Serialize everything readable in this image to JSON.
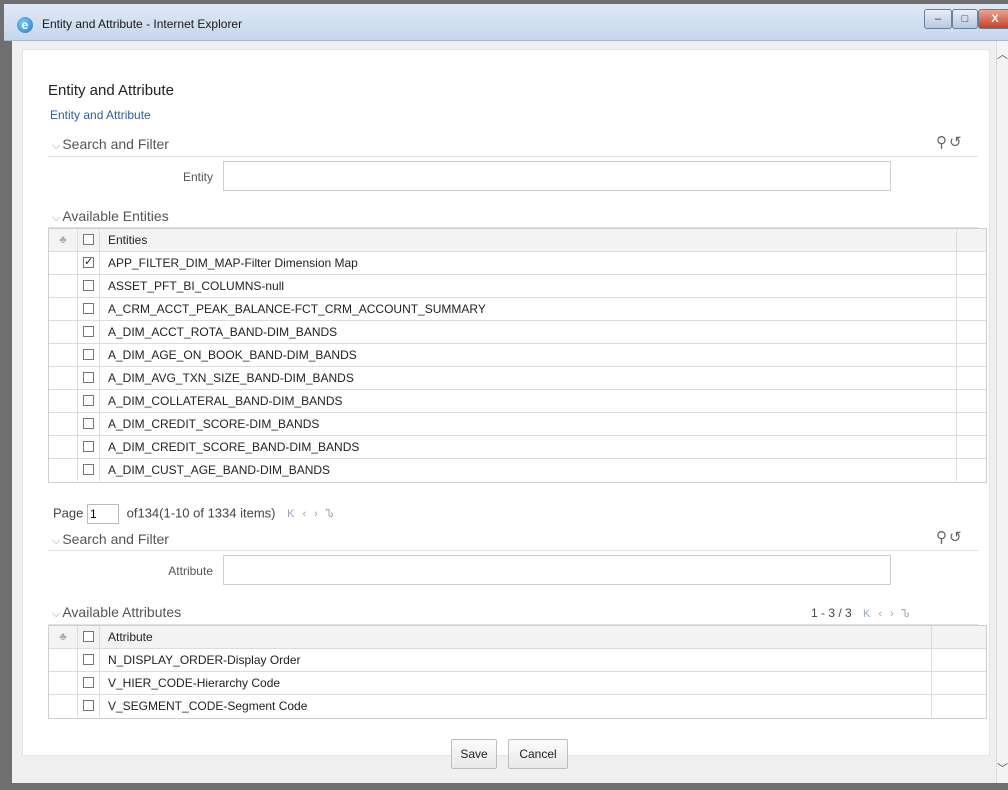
{
  "window": {
    "title": "Entity and Attribute - Internet Explorer",
    "app_icon": "internet-explorer-icon",
    "controls": {
      "minimize": "–",
      "maximize": "□",
      "close": "X"
    }
  },
  "page": {
    "title": "Entity and Attribute",
    "breadcrumb": "Entity and Attribute"
  },
  "entity_search": {
    "section_title": "Search and Filter",
    "field_label": "Entity",
    "field_value": "",
    "icons": [
      "search-icon",
      "reset-icon"
    ]
  },
  "entities": {
    "section_title": "Available Entities",
    "column_header": "Entities",
    "rows": [
      {
        "label": "APP_FILTER_DIM_MAP-Filter Dimension Map",
        "checked": true
      },
      {
        "label": "ASSET_PFT_BI_COLUMNS-null",
        "checked": false
      },
      {
        "label": "A_CRM_ACCT_PEAK_BALANCE-FCT_CRM_ACCOUNT_SUMMARY",
        "checked": false
      },
      {
        "label": "A_DIM_ACCT_ROTA_BAND-DIM_BANDS",
        "checked": false
      },
      {
        "label": "A_DIM_AGE_ON_BOOK_BAND-DIM_BANDS",
        "checked": false
      },
      {
        "label": "A_DIM_AVG_TXN_SIZE_BAND-DIM_BANDS",
        "checked": false
      },
      {
        "label": "A_DIM_COLLATERAL_BAND-DIM_BANDS",
        "checked": false
      },
      {
        "label": "A_DIM_CREDIT_SCORE-DIM_BANDS",
        "checked": false
      },
      {
        "label": "A_DIM_CREDIT_SCORE_BAND-DIM_BANDS",
        "checked": false
      },
      {
        "label": "A_DIM_CUST_AGE_BAND-DIM_BANDS",
        "checked": false
      }
    ],
    "pager": {
      "label": "Page",
      "page": "1",
      "summary": "of134(1-10 of 1334 items)"
    }
  },
  "attribute_search": {
    "section_title": "Search and Filter",
    "field_label": "Attribute",
    "field_value": "",
    "icons": [
      "search-icon",
      "reset-icon"
    ]
  },
  "attributes": {
    "section_title": "Available Attributes",
    "column_header": "Attribute",
    "range": "1 - 3 / 3",
    "rows": [
      {
        "label": "N_DISPLAY_ORDER-Display Order",
        "checked": false
      },
      {
        "label": "V_HIER_CODE-Hierarchy Code",
        "checked": false
      },
      {
        "label": "V_SEGMENT_CODE-Segment Code",
        "checked": false
      }
    ]
  },
  "buttons": {
    "save": "Save",
    "cancel": "Cancel"
  },
  "glyphs": {
    "chevron": "⌵",
    "search": "⚲",
    "reset": "↺",
    "hierarchy": "♣",
    "check": "✓",
    "first": "K",
    "prev": "‹",
    "next": "›",
    "last": "Ꮦ"
  }
}
